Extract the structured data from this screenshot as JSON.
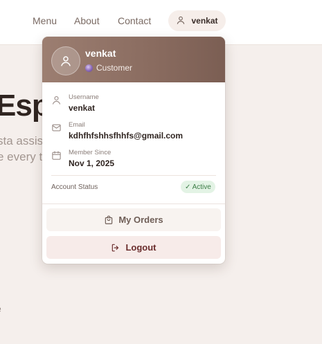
{
  "nav": {
    "menu_label": "Menu",
    "about_label": "About",
    "contact_label": "Contact",
    "user_label": "venkat"
  },
  "hero": {
    "title_fragment": "Espr",
    "line1_fragment": "sta assist",
    "line2_fragment": "e every ti",
    "small_fragment": "e"
  },
  "dropdown": {
    "name": "venkat",
    "role": "Customer",
    "fields": [
      {
        "label": "Username",
        "value": "venkat",
        "icon": "user-icon"
      },
      {
        "label": "Email",
        "value": "kdhfhfshhsfhhfs@gmail.com",
        "icon": "mail-icon"
      },
      {
        "label": "Member Since",
        "value": "Nov 1, 2025",
        "icon": "calendar-icon"
      }
    ],
    "status_label": "Account Status",
    "status_value": "✓ Active",
    "orders_label": "My Orders",
    "logout_label": "Logout"
  },
  "colors": {
    "header_gradient_start": "#9c7e71",
    "header_gradient_end": "#7b5e53",
    "status_green": "#3c7d46",
    "logout_text": "#6a2c2c"
  }
}
